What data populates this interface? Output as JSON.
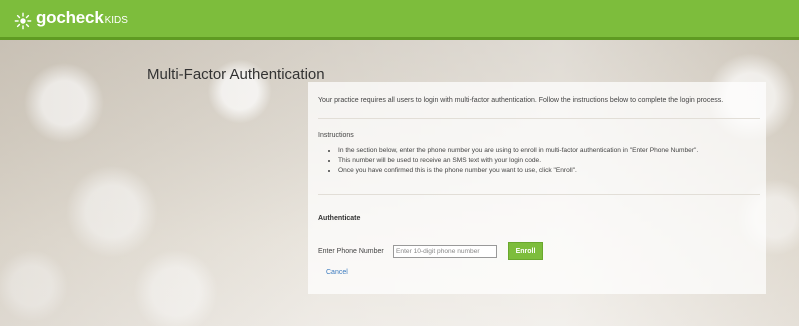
{
  "header": {
    "logo_text": "gocheck",
    "logo_sub": "KIDS",
    "brand_color": "#7dbd3c",
    "logo_icon": "sunburst-logo-icon"
  },
  "page": {
    "title": "Multi-Factor Authentication",
    "intro": "Your practice requires all users to login with multi-factor authentication. Follow the instructions below to complete the login process."
  },
  "instructions": {
    "heading": "Instructions",
    "items": [
      "In the section below, enter the phone number you are using to enroll in multi-factor authentication in \"Enter Phone Number\".",
      "This number will be used to receive an SMS text with your login code.",
      "Once you have confirmed this is the phone number you want to use, click \"Enroll\"."
    ]
  },
  "authenticate": {
    "heading": "Authenticate",
    "phone_label": "Enter Phone Number",
    "phone_placeholder": "Enter 10-digit phone number",
    "phone_value": "",
    "enroll_label": "Enroll",
    "cancel_label": "Cancel",
    "link_color": "#3b7bbf"
  }
}
